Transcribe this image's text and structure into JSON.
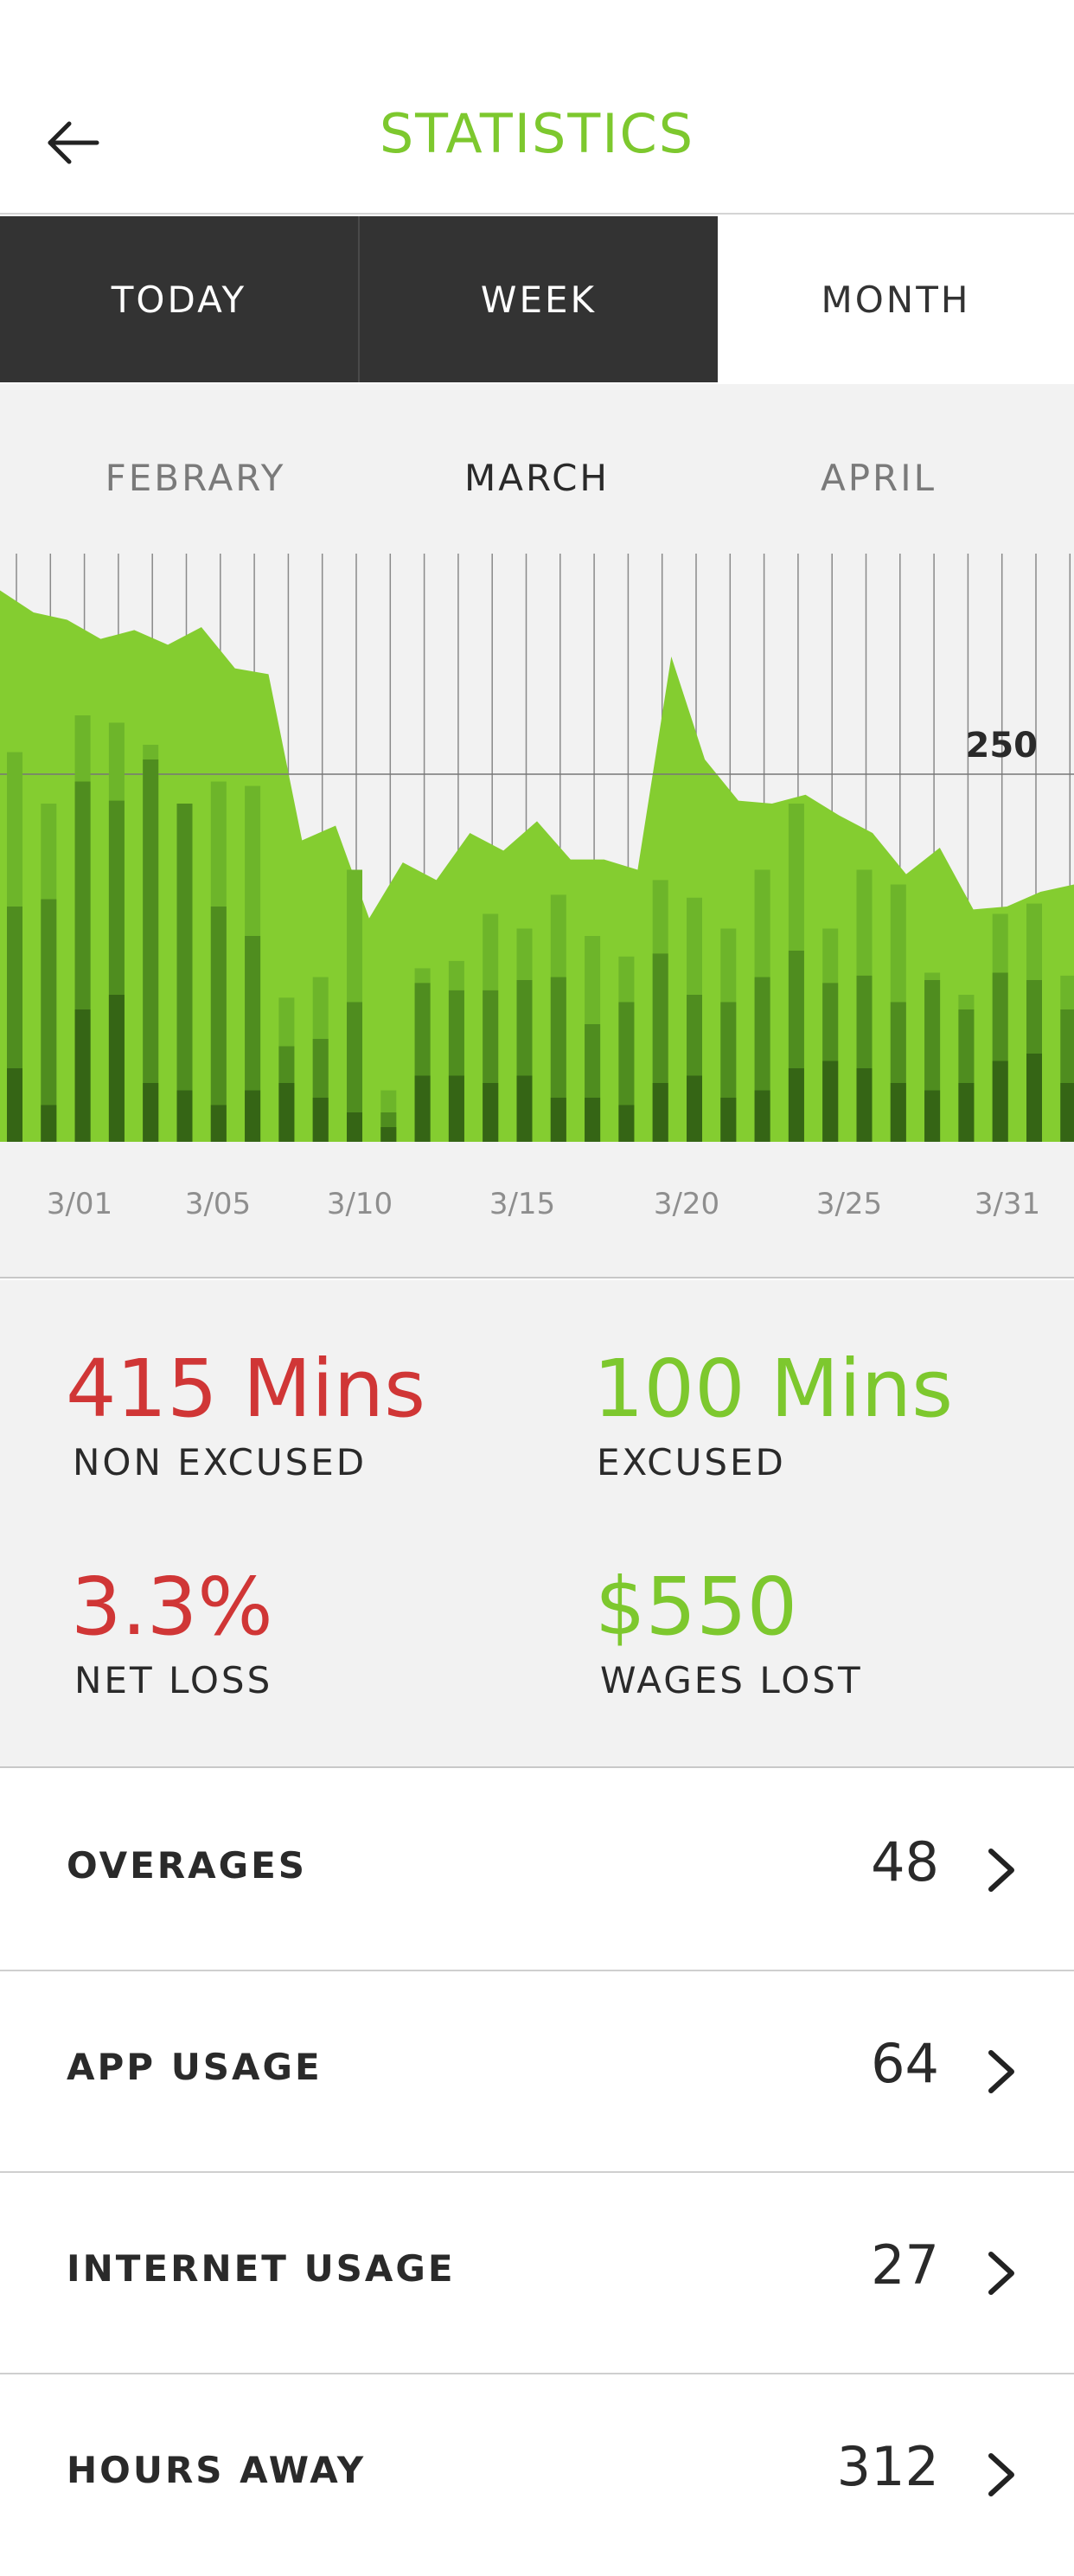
{
  "header": {
    "title": "STATISTICS",
    "title_color": "#7dc82e",
    "back_icon": "arrow-left-icon"
  },
  "tabs": [
    {
      "label": "TODAY",
      "active": false
    },
    {
      "label": "WEEK",
      "active": false
    },
    {
      "label": "MONTH",
      "active": true
    }
  ],
  "months": {
    "prev": "FEBRARY",
    "current": "MARCH",
    "next": "APRIL"
  },
  "chart_data": {
    "type": "area",
    "annotation": "250",
    "x_tick_labels": [
      "3/01",
      "3/05",
      "3/10",
      "3/15",
      "3/20",
      "3/25",
      "3/31"
    ],
    "ylim": [
      0,
      400
    ],
    "grid": true,
    "colors": {
      "area": "#84cd30",
      "bar_light": "#6db52a",
      "bar_mid": "#4f8d1f",
      "bar_dark": "#356515",
      "gridline": "#8a8a8a"
    },
    "area_series": [
      375,
      360,
      355,
      342,
      348,
      338,
      350,
      322,
      318,
      205,
      215,
      152,
      190,
      178,
      210,
      198,
      218,
      192,
      192,
      185,
      330,
      260,
      232,
      230,
      236,
      222,
      210,
      182,
      200,
      158,
      160,
      170,
      175
    ],
    "bar_series": {
      "total": [
        265,
        230,
        290,
        285,
        270,
        230,
        245,
        242,
        98,
        112,
        185,
        35,
        118,
        123,
        155,
        145,
        168,
        140,
        126,
        178,
        166,
        145,
        185,
        230,
        145,
        185,
        175,
        115,
        100,
        155,
        162,
        113
      ],
      "mid": [
        160,
        165,
        245,
        232,
        260,
        230,
        160,
        140,
        65,
        70,
        95,
        20,
        108,
        103,
        103,
        110,
        112,
        80,
        95,
        128,
        100,
        95,
        112,
        130,
        108,
        113,
        95,
        110,
        90,
        115,
        110,
        90
      ],
      "dark": [
        50,
        25,
        90,
        100,
        40,
        35,
        25,
        35,
        40,
        30,
        20,
        10,
        45,
        45,
        40,
        45,
        30,
        30,
        25,
        40,
        45,
        30,
        35,
        50,
        55,
        50,
        40,
        35,
        40,
        55,
        60,
        40
      ]
    }
  },
  "stats": {
    "non_excused_value": "415 Mins",
    "non_excused_label": "NON EXCUSED",
    "excused_value": "100 Mins",
    "excused_label": "EXCUSED",
    "net_loss_value": "3.3%",
    "net_loss_label": "NET LOSS",
    "wages_lost_value": "$550",
    "wages_lost_label": "WAGES LOST",
    "negative_color": "#d03636",
    "positive_color": "#7dc82e"
  },
  "list": [
    {
      "label": "OVERAGES",
      "value": "48"
    },
    {
      "label": "APP USAGE",
      "value": "64"
    },
    {
      "label": "INTERNET USAGE",
      "value": "27"
    },
    {
      "label": "HOURS AWAY",
      "value": "312"
    }
  ]
}
